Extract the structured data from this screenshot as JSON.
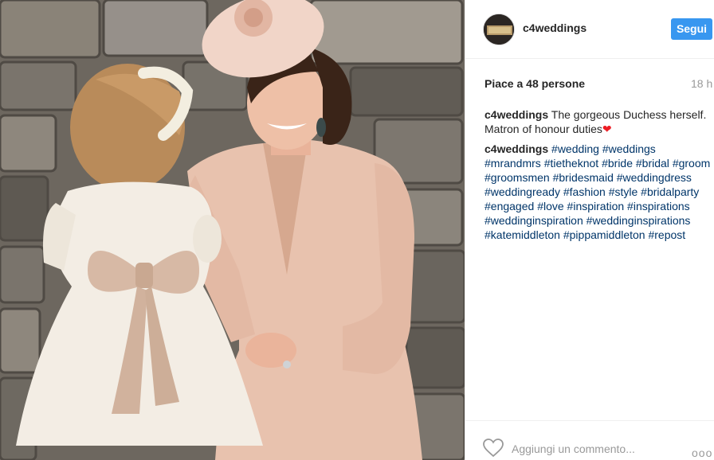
{
  "post": {
    "username": "c4weddings",
    "follow_label": "Segui",
    "avatar_text": "c4weddings",
    "likes_text": "Piace a 48 persone",
    "time_ago": "18 h",
    "caption": {
      "author": "c4weddings",
      "text": "The gorgeous Duchess herself. Matron of honour duties",
      "emoji": "❤"
    },
    "tags_comment": {
      "author": "c4weddings",
      "tags": [
        "#wedding",
        "#weddings",
        "#mrandmrs",
        "#tietheknot",
        "#bride",
        "#bridal",
        "#groom",
        "#groomsmen",
        "#bridesmaid",
        "#weddingdress",
        "#weddingready",
        "#fashion",
        "#style",
        "#bridalparty",
        "#engaged",
        "#love",
        "#inspiration",
        "#inspirations",
        "#weddinginspiration",
        "#weddinginspirations",
        "#katemiddleton",
        "#pippamiddleton",
        "#repost"
      ]
    },
    "comment_placeholder": "Aggiungi un commento...",
    "more_label": "ooo"
  },
  "icons": {
    "like": "heart-outline-icon",
    "more": "more-options-icon"
  },
  "colors": {
    "follow_bg": "#3897f0",
    "hashtag": "#003569",
    "muted": "#999999"
  }
}
